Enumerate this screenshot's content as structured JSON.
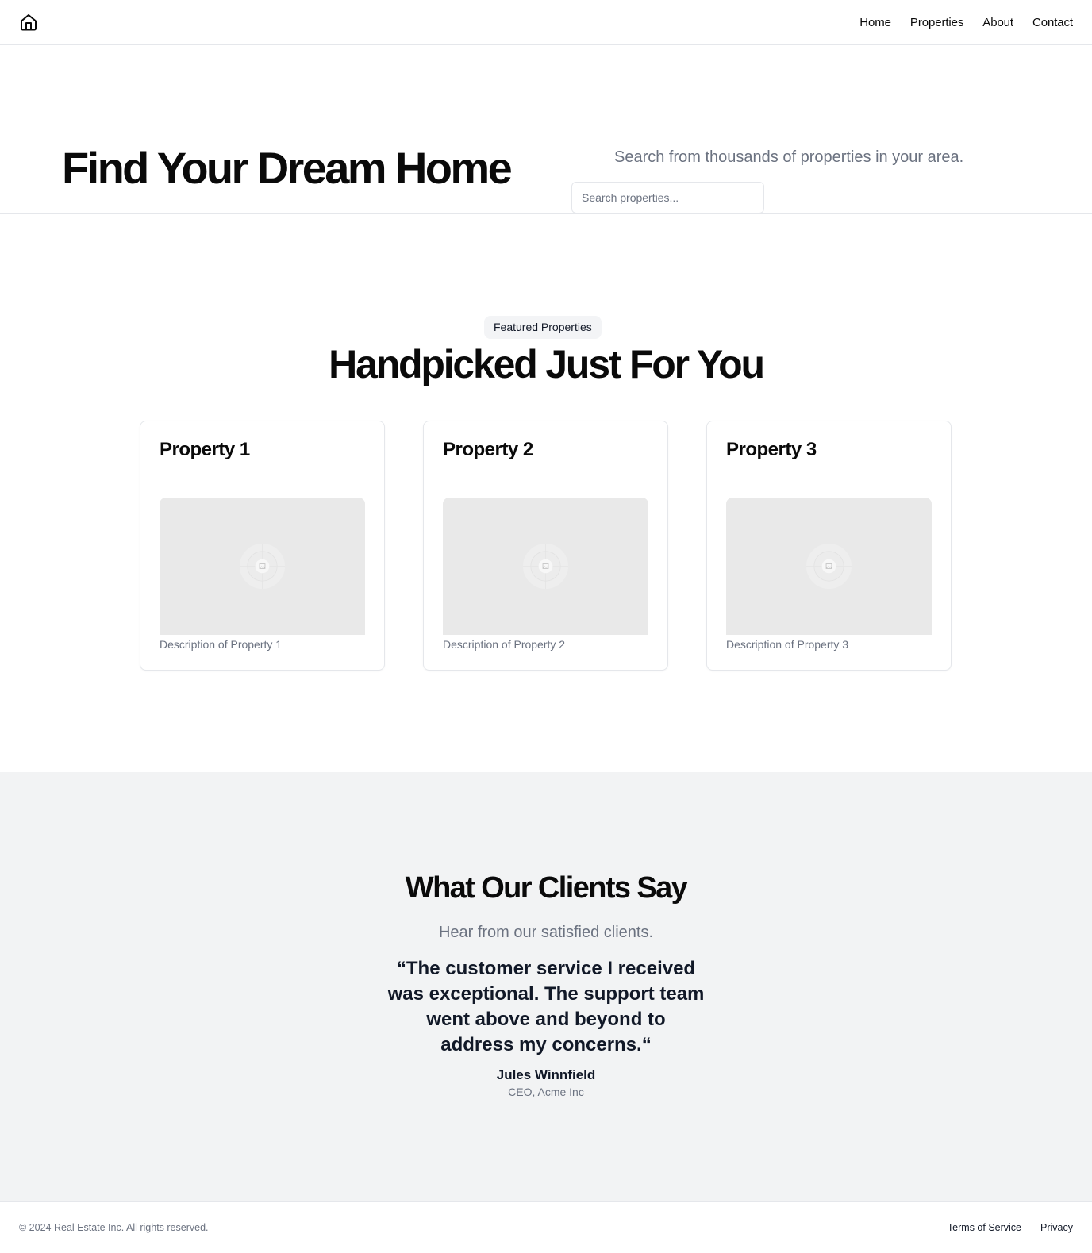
{
  "header": {
    "logo_icon": "home-icon",
    "nav": [
      {
        "label": "Home"
      },
      {
        "label": "Properties"
      },
      {
        "label": "About"
      },
      {
        "label": "Contact"
      }
    ]
  },
  "hero": {
    "title": "Find Your Dream Home",
    "subtitle": "Search from thousands of properties in your area.",
    "search_placeholder": "Search properties...",
    "search_value": ""
  },
  "featured": {
    "badge": "Featured Properties",
    "title": "Handpicked Just For You",
    "properties": [
      {
        "title": "Property 1",
        "description": "Description of Property 1",
        "image_icon": "image-placeholder-icon"
      },
      {
        "title": "Property 2",
        "description": "Description of Property 2",
        "image_icon": "image-placeholder-icon"
      },
      {
        "title": "Property 3",
        "description": "Description of Property 3",
        "image_icon": "image-placeholder-icon"
      }
    ]
  },
  "testimonials": {
    "title": "What Our Clients Say",
    "subtitle": "Hear from our satisfied clients.",
    "quote": "“The customer service I received was exceptional. The support team went above and beyond to address my concerns.“",
    "author": "Jules Winnfield",
    "role": "CEO, Acme Inc"
  },
  "footer": {
    "copyright": "© 2024 Real Estate Inc. All rights reserved.",
    "links": [
      {
        "label": "Terms of Service"
      },
      {
        "label": "Privacy"
      }
    ]
  },
  "colors": {
    "text": "#0a0a0a",
    "muted": "#6b7280",
    "border": "#e5e7eb",
    "section_bg": "#f2f3f4",
    "placeholder_bg": "#e9e9e9"
  }
}
